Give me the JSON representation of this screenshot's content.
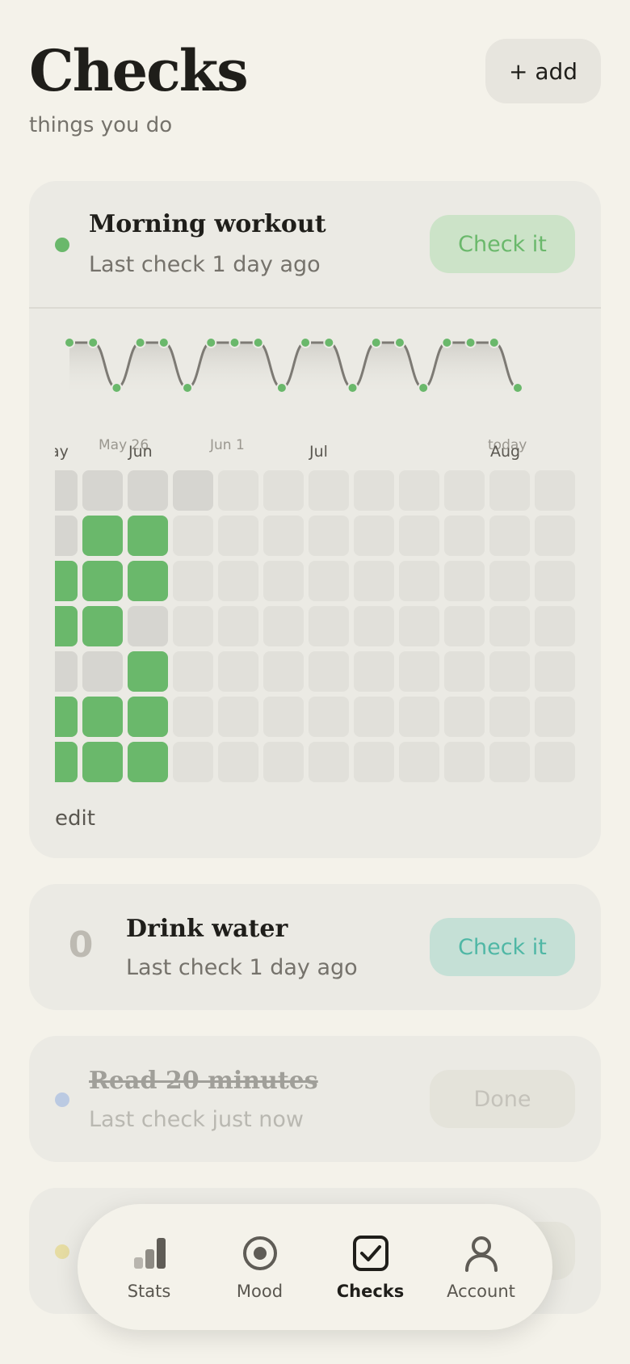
{
  "header": {
    "title": "Checks",
    "subtitle": "things you do",
    "add_label": "+ add"
  },
  "colors": {
    "background": "#f4f2ea",
    "card": "#ebeae4",
    "green": "#6ab86b",
    "teal": "#4fb7a5",
    "empty_cell": "#e1e0da",
    "past_empty_cell": "#d6d5d0"
  },
  "habits": [
    {
      "name": "Morning workout",
      "last_check": "Last check 1 day ago",
      "button": "Check it",
      "dot_color": "#6ab86b",
      "button_bg": "#cce3c8",
      "button_color": "#6ab86b",
      "spark": {
        "labels": [
          "May 26",
          "Jun 1",
          "today"
        ],
        "values": [
          1,
          1,
          0,
          1,
          1,
          0,
          1,
          1,
          1,
          0,
          1,
          1,
          0,
          1,
          1,
          0,
          1,
          1,
          1,
          0
        ]
      },
      "heatmap": {
        "months": [
          "ay",
          "Jun",
          "Jul",
          "Aug"
        ],
        "columns": [
          [
            "empty-past",
            "empty-past",
            "done",
            "done",
            "empty-past",
            "done",
            "done"
          ],
          [
            "empty-past",
            "done",
            "done",
            "done",
            "empty-past",
            "done",
            "done"
          ],
          [
            "empty-past",
            "done",
            "done",
            "empty-past",
            "done",
            "done",
            "done"
          ],
          [
            "empty-past",
            "future",
            "future",
            "future",
            "future",
            "future",
            "future"
          ]
        ],
        "future_columns": 9
      },
      "edit": "edit"
    },
    {
      "name": "Drink water",
      "last_check": "Last check 1 day ago",
      "button": "Check it",
      "count": "0",
      "button_bg": "#c5e0d6",
      "button_color": "#4fb7a5"
    },
    {
      "name": "Read 20 minutes",
      "last_check": "Last check just now",
      "button": "Done",
      "dot_color": "#7b9de0",
      "status": "done"
    },
    {
      "dot_color": "#e1c84a"
    }
  ],
  "nav": {
    "items": [
      {
        "label": "Stats",
        "icon": "bar-chart-icon"
      },
      {
        "label": "Mood",
        "icon": "mood-circle-icon"
      },
      {
        "label": "Checks",
        "icon": "checkbox-icon",
        "active": true
      },
      {
        "label": "Account",
        "icon": "person-icon"
      }
    ]
  }
}
